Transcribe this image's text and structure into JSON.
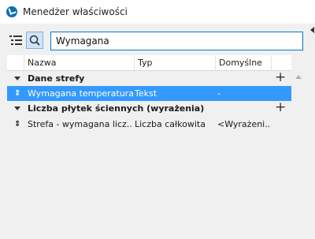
{
  "window": {
    "title": "Menedżer właściwości"
  },
  "search": {
    "value": "Wymagana"
  },
  "columns": {
    "name": "Nazwa",
    "type": "Typ",
    "default": "Domyślne"
  },
  "groups": [
    {
      "label": "Dane strefy",
      "rows": [
        {
          "name": "Wymagana temperatura",
          "type": "Tekst",
          "default": "-"
        }
      ]
    },
    {
      "label": "Liczba płytek ściennych (wyrażenia)",
      "rows": [
        {
          "name": "Strefa - wymagana licz...",
          "type": "Liczba całkowita",
          "default": "<Wyrażeni..."
        }
      ]
    }
  ],
  "colors": {
    "selection": "#3399ff",
    "accent": "#0078d7"
  }
}
